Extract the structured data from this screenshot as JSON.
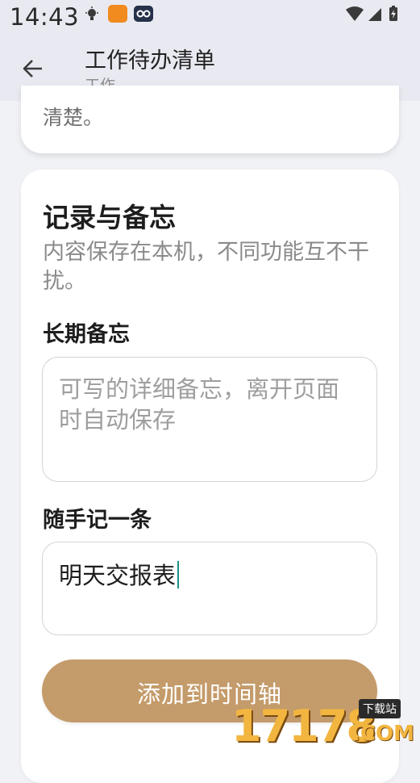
{
  "status_bar": {
    "time": "14:43",
    "icons": [
      "bulb-icon",
      "app-notification-icon",
      "app-notification-icon-2",
      "wifi-icon",
      "signal-icon",
      "battery-charging-icon"
    ]
  },
  "app_bar": {
    "back_icon": "arrow-left-icon",
    "title": "工作待办清单",
    "subtitle": "工作"
  },
  "previous_card": {
    "text": "清楚。"
  },
  "notes_card": {
    "title": "记录与备忘",
    "description": "内容保存在本机，不同功能互不干扰。",
    "long_memo": {
      "label": "长期备忘",
      "placeholder": "可写的详细备忘，离开页面时自动保存",
      "value": ""
    },
    "quick_note": {
      "label": "随手记一条",
      "value": "明天交报表"
    },
    "add_button_label": "添加到时间轴"
  },
  "watermark": {
    "number": "17178",
    "suffix": ".COM",
    "tag": "下载站"
  },
  "colors": {
    "background": "#f1f2f6",
    "app_bar": "#e9eaf1",
    "button": "#c49b6a",
    "caret": "#1a8f85"
  }
}
